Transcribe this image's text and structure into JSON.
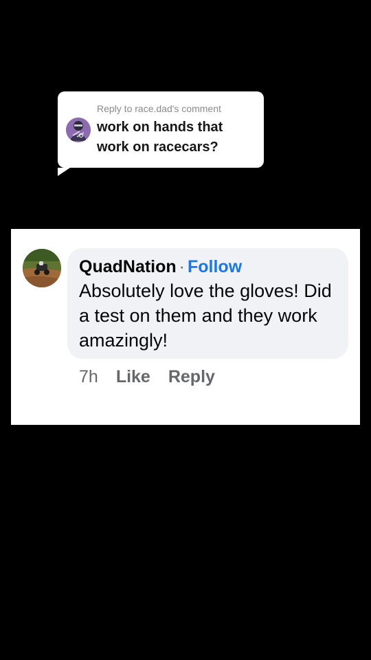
{
  "reply_sticker": {
    "header": "Reply to race.dad's comment",
    "text": "work on hands that work on racecars?",
    "avatar_icon": "racer-avatar-icon"
  },
  "comment": {
    "author": "QuadNation",
    "separator": "·",
    "follow_label": "Follow",
    "body": "Absolutely love the gloves! Did a test on them and they work amazingly!",
    "time": "7h",
    "like_label": "Like",
    "reply_label": "Reply",
    "avatar_icon": "atv-photo-avatar-icon"
  },
  "colors": {
    "background": "#000000",
    "follow_link": "#1877f2",
    "bubble": "#f0f2f5",
    "meta_text": "#65676b"
  }
}
